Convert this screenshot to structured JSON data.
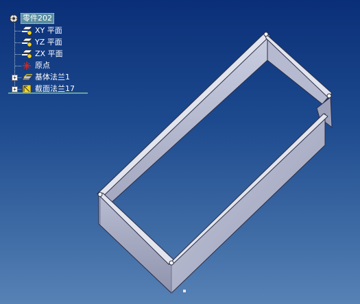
{
  "tree": {
    "root": {
      "label": "零件202",
      "icon": "part-icon"
    },
    "items": [
      {
        "label": "XY 平面",
        "icon": "plane-icon"
      },
      {
        "label": "YZ 平面",
        "icon": "plane-icon"
      },
      {
        "label": "ZX 平面",
        "icon": "plane-icon"
      },
      {
        "label": "原点",
        "icon": "origin-icon"
      },
      {
        "label": "基体法兰1",
        "icon": "base-flange-icon",
        "expandable": true
      },
      {
        "label": "截面法兰17",
        "icon": "contour-flange-icon",
        "expandable": true
      }
    ]
  },
  "viewport": {
    "model": "sheet-metal-rectangular-frame",
    "face_color": "#a9aec6",
    "top_color": "#d8dbe8",
    "edge_color": "#2a2c44"
  }
}
